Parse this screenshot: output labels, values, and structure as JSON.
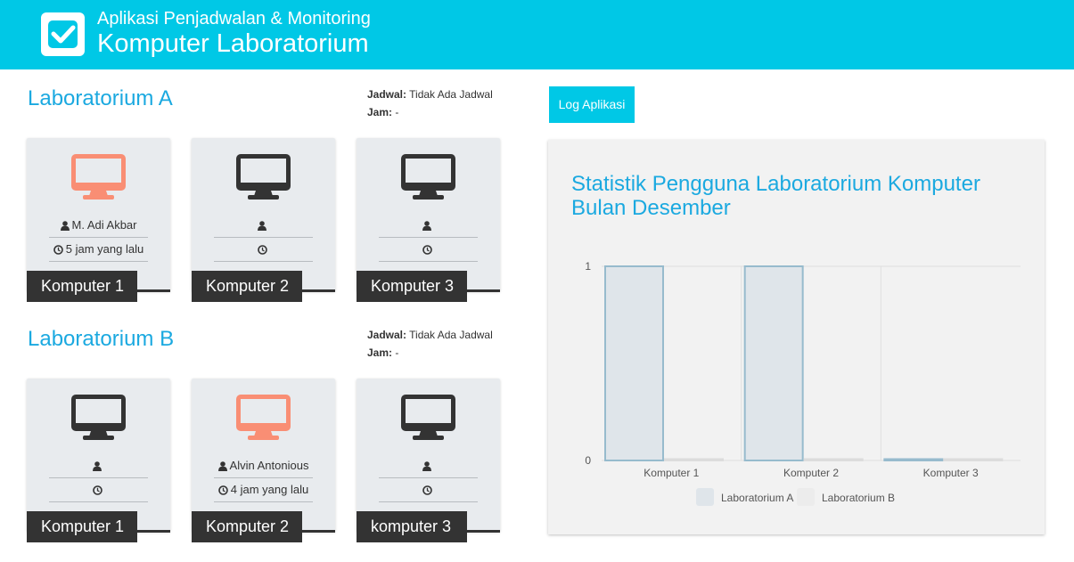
{
  "header": {
    "subtitle": "Aplikasi Penjadwalan & Monitoring",
    "title": "Komputer Laboratorium",
    "logo_icon": "checkbox-icon"
  },
  "labs": [
    {
      "name": "Laboratorium A",
      "jadwal_label": "Jadwal:",
      "jadwal_value": "Tidak Ada Jadwal",
      "jam_label": "Jam:",
      "jam_value": "-",
      "computers": [
        {
          "label": "Komputer 1",
          "user": "M. Adi Akbar",
          "time": "5 jam yang lalu",
          "status": "in-use"
        },
        {
          "label": "Komputer 2",
          "user": "",
          "time": "",
          "status": "idle"
        },
        {
          "label": "Komputer 3",
          "user": "",
          "time": "",
          "status": "idle"
        }
      ]
    },
    {
      "name": "Laboratorium B",
      "jadwal_label": "Jadwal:",
      "jadwal_value": "Tidak Ada Jadwal",
      "jam_label": "Jam:",
      "jam_value": "-",
      "computers": [
        {
          "label": "Komputer 1",
          "user": "",
          "time": "",
          "status": "idle"
        },
        {
          "label": "Komputer 2",
          "user": "Alvin Antonious",
          "time": "4 jam yang lalu",
          "status": "in-use"
        },
        {
          "label": "komputer 3",
          "user": "",
          "time": "",
          "status": "idle"
        }
      ]
    }
  ],
  "log_button": "Log Aplikasi",
  "stats": {
    "title": "Statistik Pengguna Laboratorium Komputer Bulan Desember"
  },
  "colors": {
    "accent": "#00c8e6",
    "title_blue": "#1ba9e0",
    "in_use": "#f98e74",
    "idle": "#333333"
  },
  "chart_data": {
    "type": "bar",
    "categories": [
      "Komputer 1",
      "Komputer 2",
      "Komputer 3"
    ],
    "series": [
      {
        "name": "Laboratorium A",
        "values": [
          1,
          1,
          0
        ],
        "fill": "#dfe5ea",
        "stroke": "#97bbcd"
      },
      {
        "name": "Laboratorium B",
        "values": [
          0,
          0,
          0
        ],
        "fill": "#ececec",
        "stroke": "#dcdcdc"
      }
    ],
    "ylim": [
      0,
      1
    ],
    "yticks": [
      "0",
      "1"
    ],
    "legend": "bottom",
    "grid": true
  }
}
